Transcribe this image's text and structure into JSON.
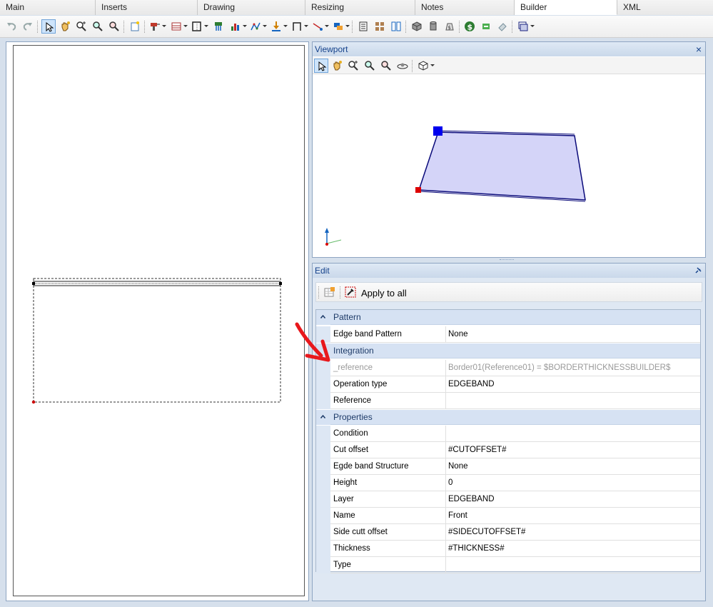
{
  "tabs": [
    {
      "label": "Main",
      "active": false
    },
    {
      "label": "Inserts",
      "active": false
    },
    {
      "label": "Drawing",
      "active": false
    },
    {
      "label": "Resizing",
      "active": false
    },
    {
      "label": "Notes",
      "active": false
    },
    {
      "label": "Builder",
      "active": true
    },
    {
      "label": "XML",
      "active": false
    }
  ],
  "viewport": {
    "title": "Viewport",
    "close_glyph": "×"
  },
  "edit": {
    "title": "Edit",
    "apply_label": "Apply to all"
  },
  "grid": {
    "categories": {
      "pattern": "Pattern",
      "integration": "Integration",
      "properties": "Properties"
    },
    "pattern_rows": [
      {
        "name": "Edge band Pattern",
        "value": "None"
      }
    ],
    "integration_rows": [
      {
        "name": "_reference",
        "value": "Border01(Reference01) = $BORDERTHICKNESSBUILDER$"
      },
      {
        "name": "Operation type",
        "value": "EDGEBAND"
      },
      {
        "name": "Reference",
        "value": ""
      }
    ],
    "properties_rows": [
      {
        "name": "Condition",
        "value": ""
      },
      {
        "name": "Cut offset",
        "value": "#CUTOFFSET#"
      },
      {
        "name": "Egde band Structure",
        "value": "None"
      },
      {
        "name": "Height",
        "value": "0"
      },
      {
        "name": "Layer",
        "value": "EDGEBAND"
      },
      {
        "name": "Name",
        "value": "Front"
      },
      {
        "name": "Side cutt offset",
        "value": "#SIDECUTOFFSET#"
      },
      {
        "name": "Thickness",
        "value": "#THICKNESS#"
      },
      {
        "name": "Type",
        "value": ""
      }
    ]
  },
  "colors": {
    "accent": "#15428b",
    "panel_fill": "#d4d4f8",
    "panel_stroke": "#0a0a7a",
    "handle_blue": "#0000ee",
    "handle_red": "#dd0000",
    "arrow_red": "#e8181c"
  },
  "icons": {
    "toolbar": [
      "undo-icon",
      "redo-icon",
      "pointer-icon",
      "pan-hand-icon",
      "zoom-in-icon",
      "zoom-window-icon",
      "zoom-extents-icon",
      "new-note-icon",
      "tool-drill-icon",
      "shelf-icon",
      "frame-icon",
      "tools-icon",
      "chart-icon",
      "curve-icon",
      "arrow-down-icon",
      "bracket-icon",
      "line-tool-icon",
      "layers-icon",
      "properties-icon",
      "grid-icon",
      "columns-icon",
      "cube-icon",
      "cylinder-icon",
      "money-bag-icon",
      "dollar-icon",
      "arrows-icon",
      "eraser-icon",
      "window-icon"
    ],
    "viewport_toolbar": [
      "pointer-icon",
      "pan-hand-icon",
      "zoom-in-icon",
      "zoom-window-icon",
      "zoom-extents-icon",
      "orbit-icon",
      "view-cube-icon"
    ]
  }
}
